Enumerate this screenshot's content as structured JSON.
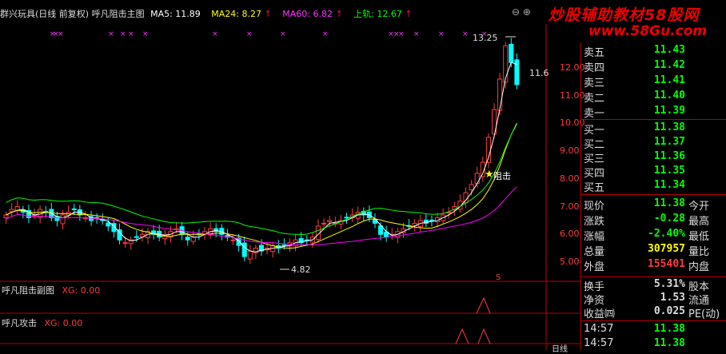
{
  "header": {
    "title": "群兴玩具(日线 前复权) 呼凡阻击主图",
    "ma5": "MA5: 11.89",
    "ma24": "MA24: 8.27",
    "ma60": "MA60: 6.82",
    "upper": "上轨: 12.67"
  },
  "watermark": {
    "line1": "炒股辅助教材58股网",
    "line2": "www.58Gu.com"
  },
  "chart": {
    "price_labels": [
      "12.00",
      "11.00",
      "10.00",
      "9.00",
      "8.00",
      "7.00",
      "6.00",
      "5.00"
    ],
    "high_label": "13.25",
    "low_label": "4.82",
    "last_label": "11.6",
    "signal_label": "阻击",
    "sub1_title": "呼凡阻击副图",
    "sub1_value": "XG: 0.00",
    "sub2_title": "呼凡攻击",
    "sub2_value": "XG: 0.00",
    "marker_s": "S",
    "date_label": "日线",
    "colors": {
      "up": "#ff3b3b",
      "down": "#00ffff",
      "ma5": "#ffffff",
      "ma24": "#ffff00",
      "ma60": "#ff00ff",
      "upper": "#00ff00"
    }
  },
  "quote": {
    "asks": [
      {
        "label": "卖五",
        "price": "11.43"
      },
      {
        "label": "卖四",
        "price": "11.42"
      },
      {
        "label": "卖三",
        "price": "11.41"
      },
      {
        "label": "卖二",
        "price": "11.40"
      },
      {
        "label": "卖一",
        "price": "11.39"
      }
    ],
    "bids": [
      {
        "label": "买一",
        "price": "11.38"
      },
      {
        "label": "买二",
        "price": "11.37"
      },
      {
        "label": "买三",
        "price": "11.36"
      },
      {
        "label": "买四",
        "price": "11.35"
      },
      {
        "label": "买五",
        "price": "11.34"
      }
    ],
    "stats": [
      {
        "label": "现价",
        "value": "11.38",
        "label2": "今开"
      },
      {
        "label": "涨跌",
        "value": "-0.28",
        "label2": "最高"
      },
      {
        "label": "涨幅",
        "value": "-2.40%",
        "label2": "最低"
      },
      {
        "label": "总量",
        "value": "307957",
        "label2": "量比"
      },
      {
        "label": "外盘",
        "value": "155401",
        "label2": "内盘"
      }
    ],
    "stats2": [
      {
        "label": "换手",
        "value": "5.31%",
        "label2": "股本"
      },
      {
        "label": "净资",
        "value": "1.53",
        "label2": "流通"
      },
      {
        "label": "收益㈣",
        "value": "0.025",
        "label2": "PE(动)"
      }
    ],
    "ticks": [
      {
        "time": "14:57",
        "price": "11.38"
      },
      {
        "time": "14:57",
        "price": "11.38"
      }
    ]
  }
}
